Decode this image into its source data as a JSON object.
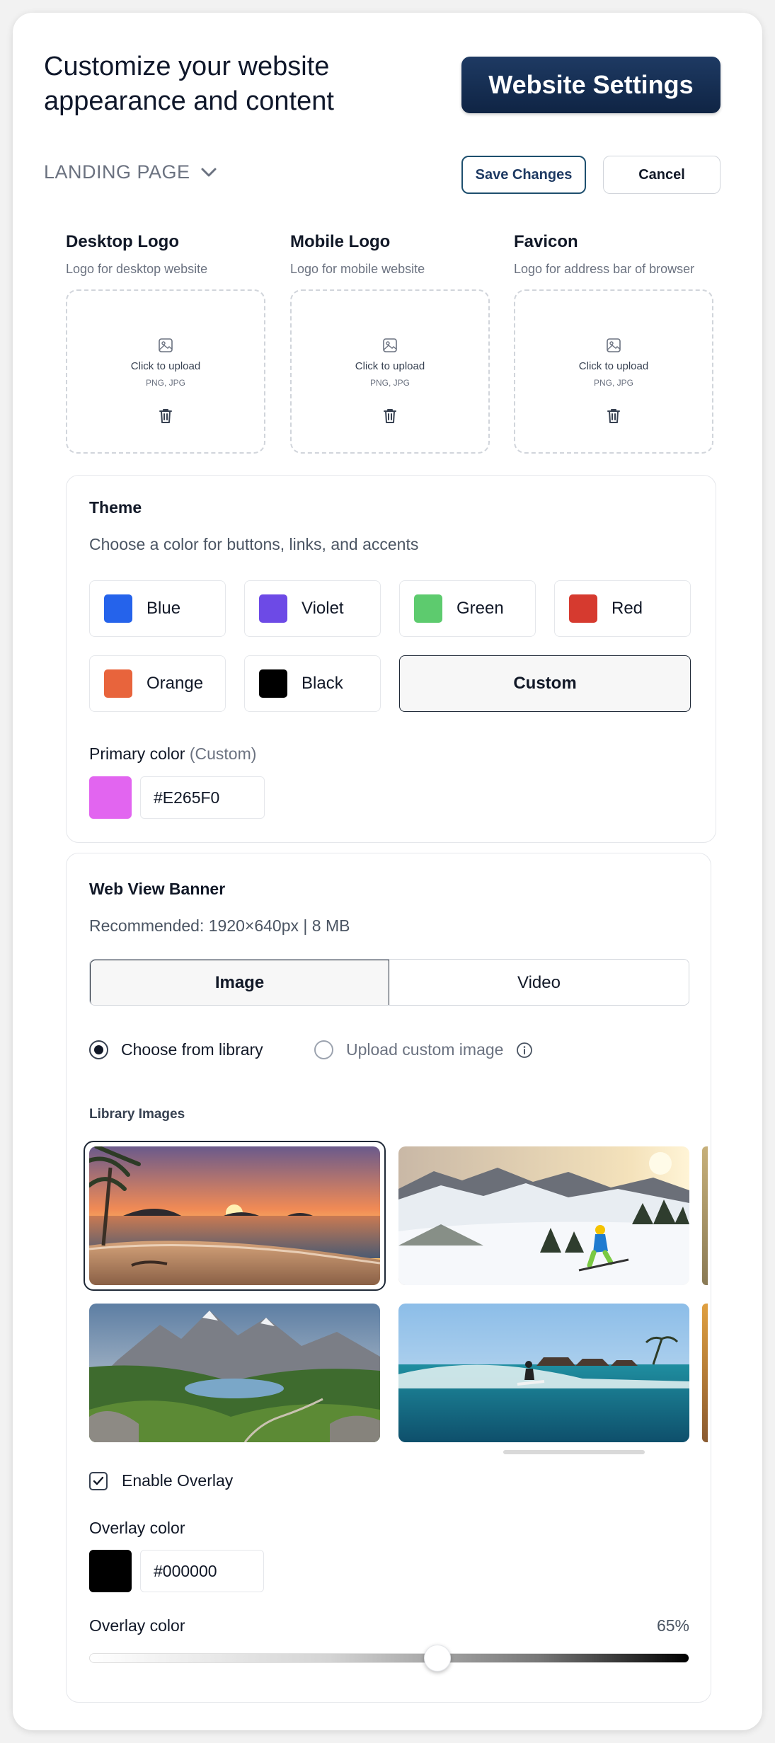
{
  "header": {
    "headline_line1": "Customize your website",
    "headline_line2": "appearance and content",
    "settings_button": "Website Settings"
  },
  "toolbar": {
    "page_selector": "LANDING PAGE",
    "save_label": "Save Changes",
    "cancel_label": "Cancel"
  },
  "logos": [
    {
      "title": "Desktop Logo",
      "subtitle": "Logo for desktop website",
      "upload_text": "Click to upload",
      "formats": "PNG, JPG"
    },
    {
      "title": "Mobile Logo",
      "subtitle": "Logo for mobile website",
      "upload_text": "Click to upload",
      "formats": "PNG, JPG"
    },
    {
      "title": "Favicon",
      "subtitle": "Logo for address bar of browser",
      "upload_text": "Click to upload",
      "formats": "PNG, JPG"
    }
  ],
  "theme": {
    "title": "Theme",
    "subtitle": "Choose a color for buttons, links, and accents",
    "options": [
      {
        "label": "Blue",
        "color": "#2563EB"
      },
      {
        "label": "Violet",
        "color": "#6D4AE6"
      },
      {
        "label": "Green",
        "color": "#5DCB6E"
      },
      {
        "label": "Red",
        "color": "#D63A2F"
      },
      {
        "label": "Orange",
        "color": "#E8643C"
      },
      {
        "label": "Black",
        "color": "#000000"
      }
    ],
    "custom_label": "Custom",
    "primary_label": "Primary color",
    "primary_mode": "(Custom)",
    "primary_hex": "#E265F0"
  },
  "banner": {
    "title": "Web View Banner",
    "recommended": "Recommended: 1920×640px | 8 MB",
    "tabs": [
      "Image",
      "Video"
    ],
    "active_tab": "Image",
    "radio_library": "Choose from library",
    "radio_upload": "Upload custom image",
    "selected_radio": "Choose from library",
    "library_label": "Library Images",
    "images": [
      "beach-sunset",
      "ski-slope",
      "mountain-lake",
      "surf-wave"
    ],
    "selected_image": "beach-sunset",
    "overlay_enabled_label": "Enable Overlay",
    "overlay_enabled": true,
    "overlay_color_label": "Overlay color",
    "overlay_hex": "#000000",
    "opacity_label": "Overlay color",
    "opacity_value": "65%",
    "opacity": 0.58
  }
}
